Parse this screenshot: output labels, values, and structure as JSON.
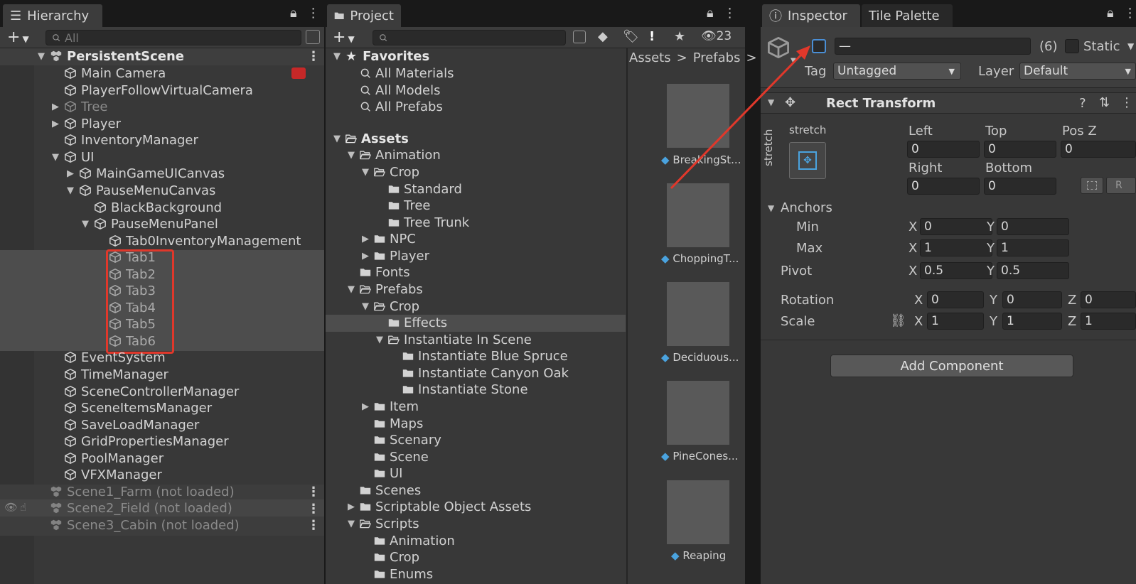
{
  "hierarchy": {
    "tab_label": "Hierarchy",
    "search_placeholder": "All",
    "scene_root": "PersistentScene",
    "items": [
      {
        "label": "Main Camera"
      },
      {
        "label": "PlayerFollowVirtualCamera"
      },
      {
        "label": "Tree"
      },
      {
        "label": "Player"
      },
      {
        "label": "InventoryManager"
      },
      {
        "label": "UI"
      },
      {
        "label": "MainGameUICanvas"
      },
      {
        "label": "PauseMenuCanvas"
      },
      {
        "label": "BlackBackground"
      },
      {
        "label": "PauseMenuPanel"
      },
      {
        "label": "Tab0InventoryManagement"
      },
      {
        "label": "Tab1"
      },
      {
        "label": "Tab2"
      },
      {
        "label": "Tab3"
      },
      {
        "label": "Tab4"
      },
      {
        "label": "Tab5"
      },
      {
        "label": "Tab6"
      },
      {
        "label": "EventSystem"
      },
      {
        "label": "TimeManager"
      },
      {
        "label": "SceneControllerManager"
      },
      {
        "label": "SceneItemsManager"
      },
      {
        "label": "SaveLoadManager"
      },
      {
        "label": "GridPropertiesManager"
      },
      {
        "label": "PoolManager"
      },
      {
        "label": "VFXManager"
      }
    ],
    "scenes": [
      {
        "label": "Scene1_Farm (not loaded)"
      },
      {
        "label": "Scene2_Field (not loaded)"
      },
      {
        "label": "Scene3_Cabin (not loaded)"
      }
    ]
  },
  "project": {
    "tab_label": "Project",
    "hidden_count": "23",
    "favorites": {
      "label": "Favorites",
      "items": [
        "All Materials",
        "All Models",
        "All Prefabs"
      ]
    },
    "tree": [
      "Assets",
      "Animation",
      "Crop",
      "Standard",
      "Tree",
      "Tree Trunk",
      "NPC",
      "Player",
      "Fonts",
      "Prefabs",
      "Crop",
      "Effects",
      "Instantiate In Scene",
      "Instantiate Blue Spruce",
      "Instantiate Canyon Oak",
      "Instantiate Stone",
      "Item",
      "Maps",
      "Scenary",
      "Scene",
      "UI",
      "Scenes",
      "Scriptable Object Assets",
      "Scripts",
      "Animation",
      "Crop",
      "Enums"
    ],
    "breadcrumb": [
      "Assets",
      "Prefabs"
    ],
    "assets": [
      "BreakingSt...",
      "ChoppingT...",
      "Deciduous...",
      "PineCones...",
      "Reaping"
    ]
  },
  "inspector": {
    "tab_label": "Inspector",
    "tab2_label": "Tile Palette",
    "name_value": "—",
    "count": "(6)",
    "static_label": "Static",
    "tag_label": "Tag",
    "tag_value": "Untagged",
    "layer_label": "Layer",
    "layer_value": "Default",
    "component_title": "Rect Transform",
    "stretch_h": "stretch",
    "stretch_v": "stretch",
    "left_label": "Left",
    "top_label": "Top",
    "posz_label": "Pos Z",
    "left_value": "0",
    "top_value": "0",
    "posz_value": "0",
    "right_label": "Right",
    "bottom_label": "Bottom",
    "right_value": "0",
    "bottom_value": "0",
    "r_button": "R",
    "anchors_label": "Anchors",
    "min_label": "Min",
    "max_label": "Max",
    "pivot_label": "Pivot",
    "rotation_label": "Rotation",
    "scale_label": "Scale",
    "x": "X",
    "y": "Y",
    "z": "Z",
    "min_x": "0",
    "min_y": "0",
    "max_x": "1",
    "max_y": "1",
    "pivot_x": "0.5",
    "pivot_y": "0.5",
    "rot_x": "0",
    "rot_y": "0",
    "rot_z": "0",
    "scale_x": "1",
    "scale_y": "1",
    "scale_z": "1",
    "add_component": "Add Component"
  },
  "colors": {
    "annotation_red": "#e0382b",
    "selection": "#4d4d4d",
    "accent_blue": "#4aa3df"
  }
}
